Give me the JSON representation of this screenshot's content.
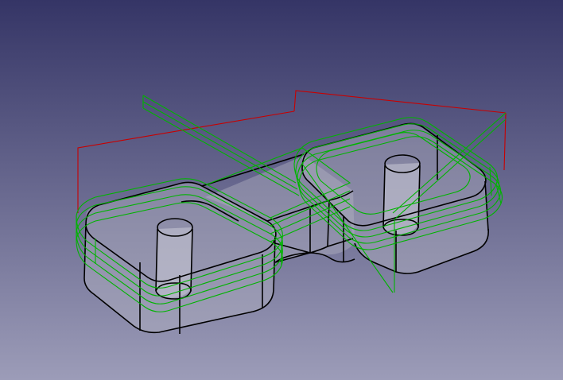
{
  "viewport": {
    "background_top": "#353566",
    "background_bottom": "#9c9cb8"
  },
  "part": {
    "edge_color": "#000000",
    "face_color": "#b4b4c4",
    "face_opacity": 0.42,
    "hole_face_color": "#c8c8d6"
  },
  "toolpath": {
    "cut_color": "#00b400",
    "rapid_color": "#c80000"
  }
}
